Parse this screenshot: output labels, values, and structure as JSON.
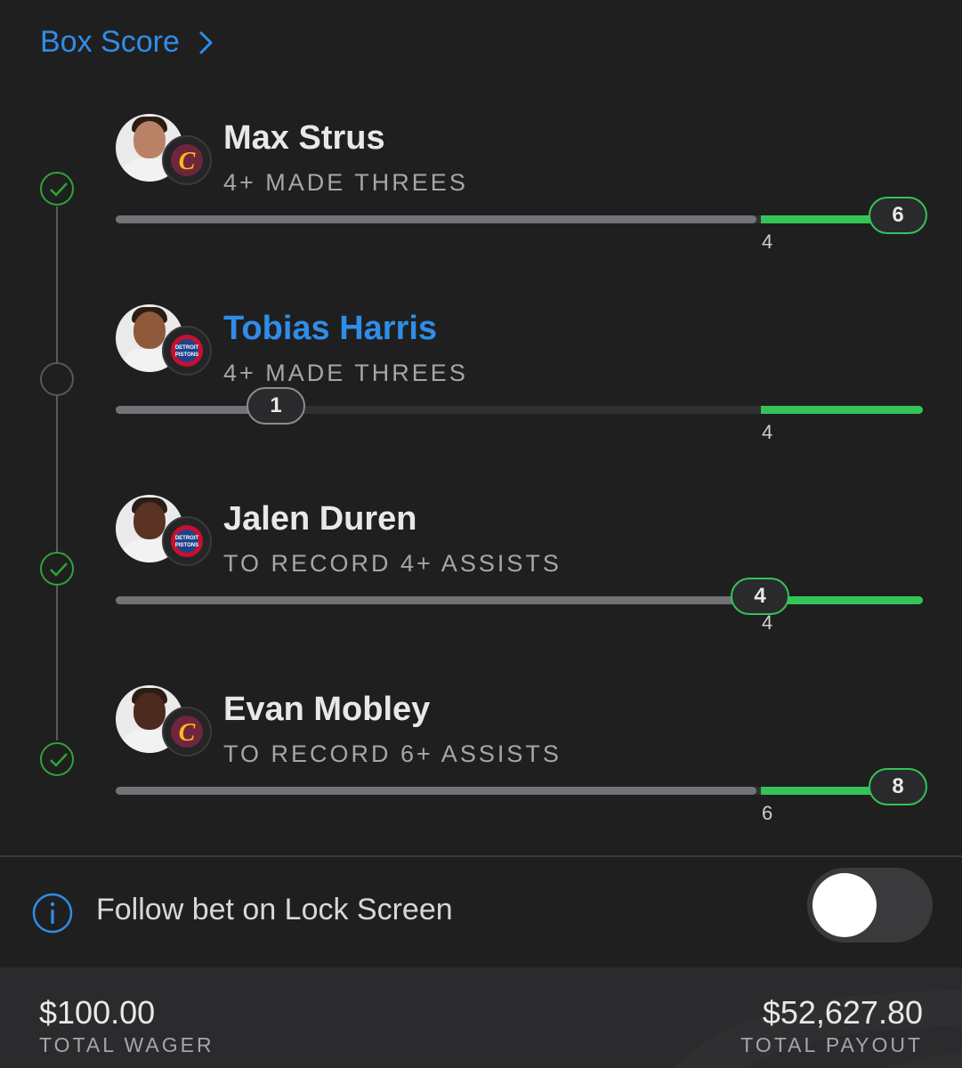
{
  "header": {
    "link_label": "Box Score"
  },
  "legs": [
    {
      "player": "Max Strus",
      "team": "Cleveland Cavaliers",
      "team_logo": "cavaliers-c-logo",
      "prop": "4+ MADE THREES",
      "threshold": "4",
      "current": "6",
      "status": "hit",
      "progress_fraction": 1.0,
      "name_color": "#e8e8e8",
      "skin": "#b98266",
      "jersey": "#f2f2f2"
    },
    {
      "player": "Tobias Harris",
      "team": "Detroit Pistons",
      "team_logo": "pistons-logo",
      "prop": "4+ MADE THREES",
      "threshold": "4",
      "current": "1",
      "status": "pending",
      "progress_fraction": 0.2,
      "name_color": "#2f8de8",
      "skin": "#8f5a3c",
      "jersey": "#f2f2f2"
    },
    {
      "player": "Jalen Duren",
      "team": "Detroit Pistons",
      "team_logo": "pistons-logo",
      "prop": "TO RECORD 4+ ASSISTS",
      "threshold": "4",
      "current": "4",
      "status": "hit",
      "progress_fraction": 0.8,
      "name_color": "#e8e8e8",
      "skin": "#5a3324",
      "jersey": "#f2f2f2"
    },
    {
      "player": "Evan Mobley",
      "team": "Cleveland Cavaliers",
      "team_logo": "cavaliers-c-logo",
      "prop": "TO RECORD 6+ ASSISTS",
      "threshold": "6",
      "current": "8",
      "status": "hit",
      "progress_fraction": 1.0,
      "name_color": "#e8e8e8",
      "skin": "#4c2a1d",
      "jersey": "#f2f2f2"
    }
  ],
  "follow": {
    "label": "Follow bet on Lock Screen",
    "toggle_on": false
  },
  "footer": {
    "wager_amount": "$100.00",
    "wager_label": "TOTAL WAGER",
    "payout_amount": "$52,627.80",
    "payout_label": "TOTAL PAYOUT"
  },
  "colors": {
    "accent_blue": "#2f8de8",
    "success_green": "#35c358",
    "check_green": "#2fa338",
    "background": "#1f1f20"
  }
}
